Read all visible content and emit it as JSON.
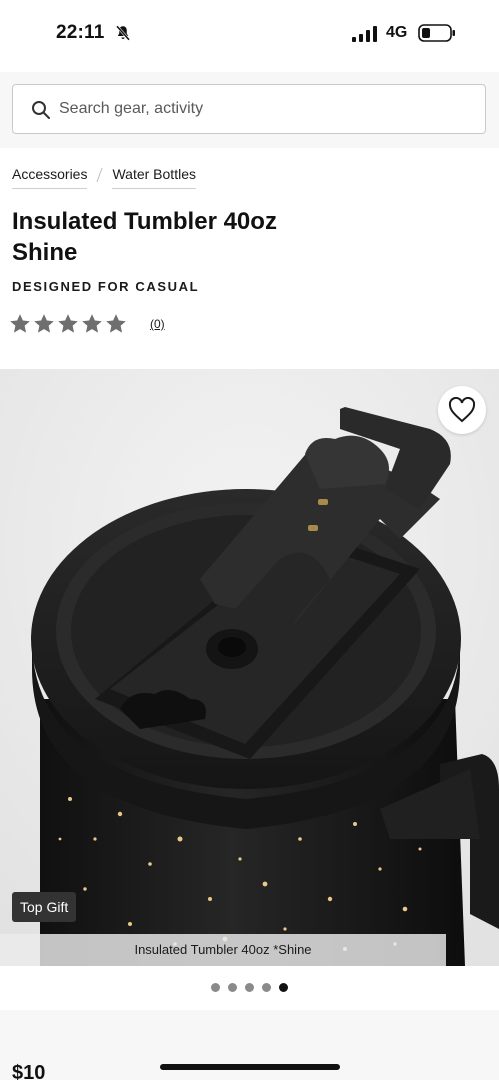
{
  "status_bar": {
    "time": "22:11",
    "network": "4G"
  },
  "search": {
    "placeholder": "Search gear, activity",
    "value": ""
  },
  "breadcrumb": [
    "Accessories",
    "Water Bottles"
  ],
  "product": {
    "title": "Insulated Tumbler 40oz Shine",
    "designed_for": "DESIGNED FOR CASUAL",
    "rating_stars": 5,
    "review_count": "(0)",
    "badge": "Top Gift",
    "image_caption": "Insulated Tumbler 40oz *Shine",
    "price_peek": "$10"
  },
  "gallery": {
    "total_images": 5,
    "active_index": 4
  },
  "icons": {
    "bell": "bell-slash-icon",
    "search": "search-icon",
    "wishlist": "heart-outline-icon",
    "star": "star-icon"
  },
  "colors": {
    "star": "#6f6f6f",
    "badge_bg": "#333333",
    "tumbler": "#1c1c1c",
    "sparkle": "#e8c98a"
  }
}
